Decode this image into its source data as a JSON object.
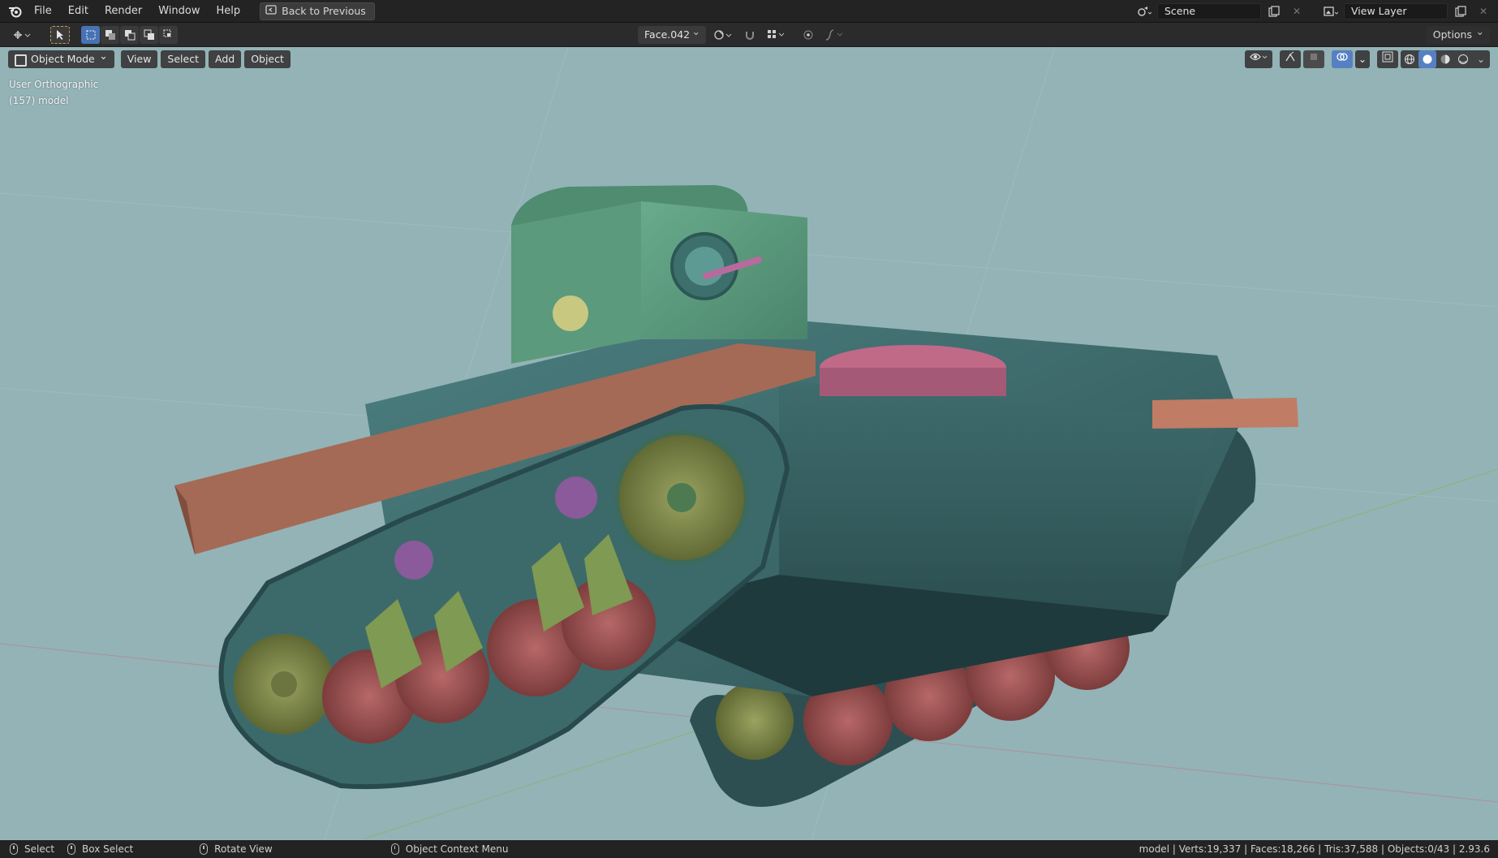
{
  "menu": {
    "items": [
      "File",
      "Edit",
      "Render",
      "Window",
      "Help"
    ],
    "back_label": "Back to Previous"
  },
  "scene": {
    "label": "Scene",
    "view_layer": "View Layer"
  },
  "toolbar": {
    "mesh_name": "Face.042",
    "options_label": "Options"
  },
  "viewport": {
    "mode_label": "Object Mode",
    "menus": [
      "View",
      "Select",
      "Add",
      "Object"
    ],
    "info_line1": "User Orthographic",
    "info_line2": "(157) model"
  },
  "statusbar": {
    "select": "Select",
    "box_select": "Box Select",
    "rotate_view": "Rotate View",
    "context_menu": "Object Context Menu",
    "stats": "model | Verts:19,337 | Faces:18,266 | Tris:37,588 | Objects:0/43 | 2.93.6"
  },
  "colors": {
    "viewport_bg": "#93b3b7",
    "hull": "#3e6a6b",
    "turret": "#5c9a7c",
    "plank": "#a46a55",
    "road_wheel": "#9c5050",
    "sprocket": "#7f8a4a",
    "accent_blue": "#4772b3"
  },
  "icons": [
    "blender-logo-icon",
    "back-icon",
    "editor-type-icon",
    "select-cursor-icon",
    "select-mode-icons",
    "pivot-icon",
    "snap-icon",
    "proportional-icon",
    "visibility-icon",
    "gizmo-icon",
    "overlay-icon",
    "xray-icon",
    "shading-icons",
    "mouse-icon"
  ]
}
